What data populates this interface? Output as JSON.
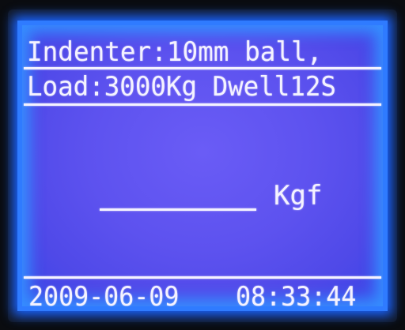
{
  "header": {
    "line1": "Indenter:10mm ball,",
    "line2": "Load:3000Kg Dwell12S"
  },
  "measurement": {
    "unit": "Kgf"
  },
  "footer": {
    "date": "2009-06-09",
    "time": "08:33:44"
  },
  "colors": {
    "screen_background": "#5d52ef",
    "screen_border_glow": "#2f7bff",
    "text": "#f4f2ff"
  }
}
